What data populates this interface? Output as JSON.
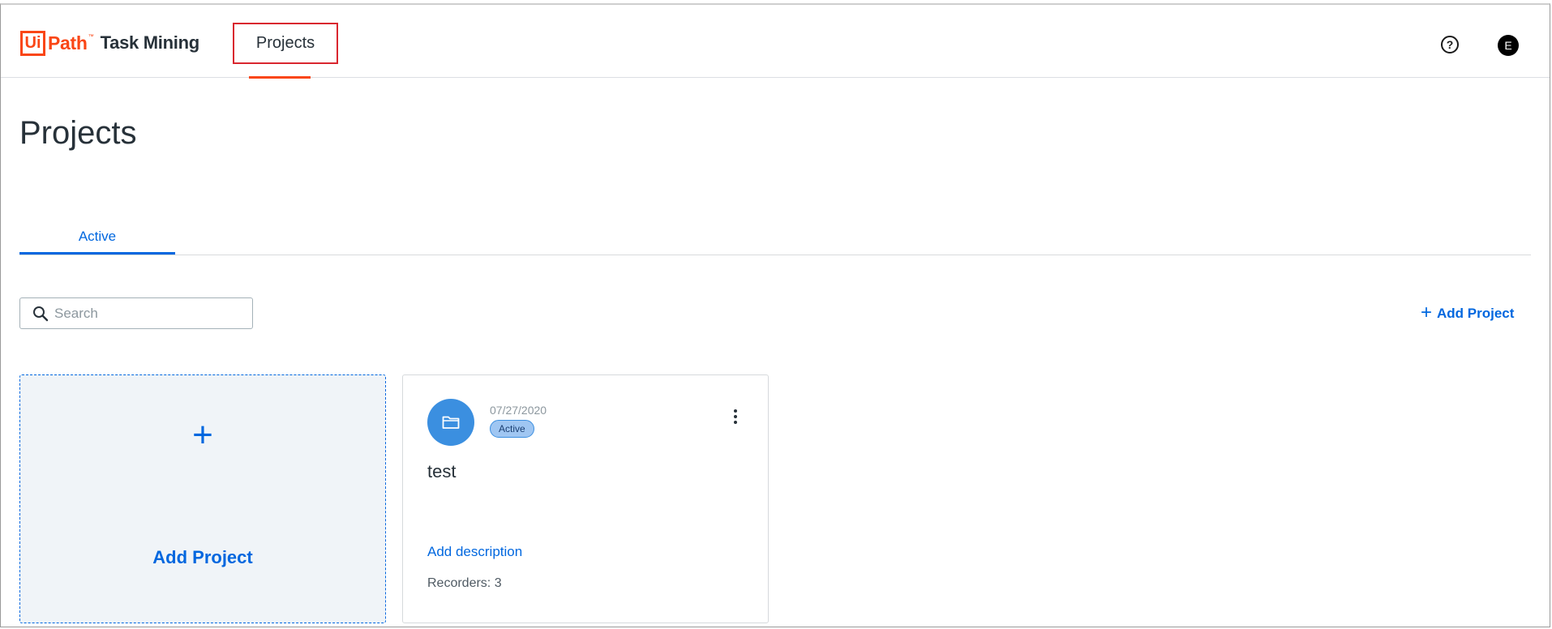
{
  "header": {
    "logo": {
      "ui": "Ui",
      "path": "Path",
      "tm": "™",
      "product": "Task Mining"
    },
    "nav": {
      "projects_label": "Projects"
    },
    "help_label": "?",
    "user_initial": "E"
  },
  "page": {
    "title": "Projects"
  },
  "tabs": [
    {
      "label": "Active",
      "selected": true
    }
  ],
  "search": {
    "placeholder": "Search",
    "value": ""
  },
  "actions": {
    "add_project_label": "Add Project",
    "add_project_icon": "plus-icon"
  },
  "add_card": {
    "label": "Add Project",
    "icon": "plus-icon"
  },
  "projects": [
    {
      "date": "07/27/2020",
      "status": "Active",
      "name": "test",
      "description_link": "Add description",
      "recorders": "Recorders: 3",
      "icon": "folder-icon"
    }
  ],
  "colors": {
    "brand_orange": "#fa4616",
    "accent_blue": "#0067df",
    "avatar_blue": "#3b8fe0",
    "highlight_red": "#d9262f"
  }
}
